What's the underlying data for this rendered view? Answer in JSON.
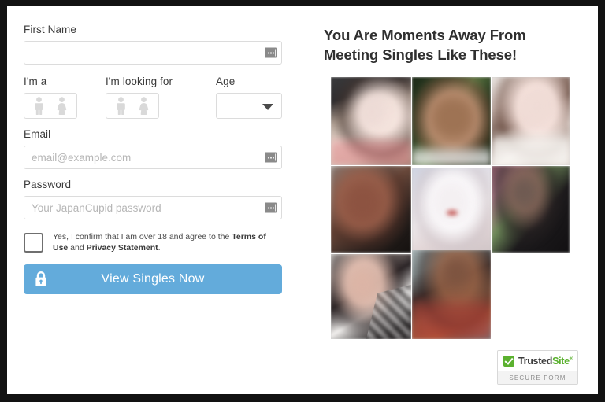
{
  "frame": {
    "background_color": "#121212",
    "card_color": "#ffffff"
  },
  "form": {
    "first_name": {
      "label": "First Name",
      "value": "",
      "placeholder": ""
    },
    "im_a": {
      "label": "I'm a",
      "options": [
        "male",
        "female"
      ],
      "selected": ""
    },
    "im_looking_for": {
      "label": "I'm looking for",
      "options": [
        "male",
        "female"
      ],
      "selected": ""
    },
    "age": {
      "label": "Age",
      "value": "",
      "placeholder": ""
    },
    "email": {
      "label": "Email",
      "value": "",
      "placeholder": "email@example.com"
    },
    "password": {
      "label": "Password",
      "value": "",
      "placeholder": "Your JapanCupid password"
    },
    "terms": {
      "checked": false,
      "text_part1": "Yes, I confirm that I am over 18 and agree to the ",
      "terms_link": "Terms of Use",
      "text_part2": " and ",
      "privacy_link": "Privacy Statement",
      "text_part3": "."
    },
    "submit": {
      "label": "View Singles Now",
      "icon": "lock-icon",
      "color": "#63abdb"
    }
  },
  "promo": {
    "headline_line1": "You Are Moments Away From",
    "headline_line2": "Meeting Singles Like These!",
    "photos": [
      {
        "id": 1,
        "alt": "blurred-profile-photo-1"
      },
      {
        "id": 2,
        "alt": "blurred-profile-photo-2"
      },
      {
        "id": 3,
        "alt": "blurred-profile-photo-3"
      },
      {
        "id": 4,
        "alt": "blurred-profile-photo-4"
      },
      {
        "id": 5,
        "alt": "blurred-profile-photo-5"
      },
      {
        "id": 6,
        "alt": "blurred-profile-photo-6"
      },
      {
        "id": 7,
        "alt": "blurred-profile-photo-7"
      },
      {
        "id": 8,
        "alt": "blurred-profile-photo-8"
      }
    ]
  },
  "trust_badge": {
    "name_part1": "Trusted",
    "name_part2": "Site",
    "registered_mark": "®",
    "subtitle": "SECURE FORM",
    "check_color": "#5bb12f"
  }
}
